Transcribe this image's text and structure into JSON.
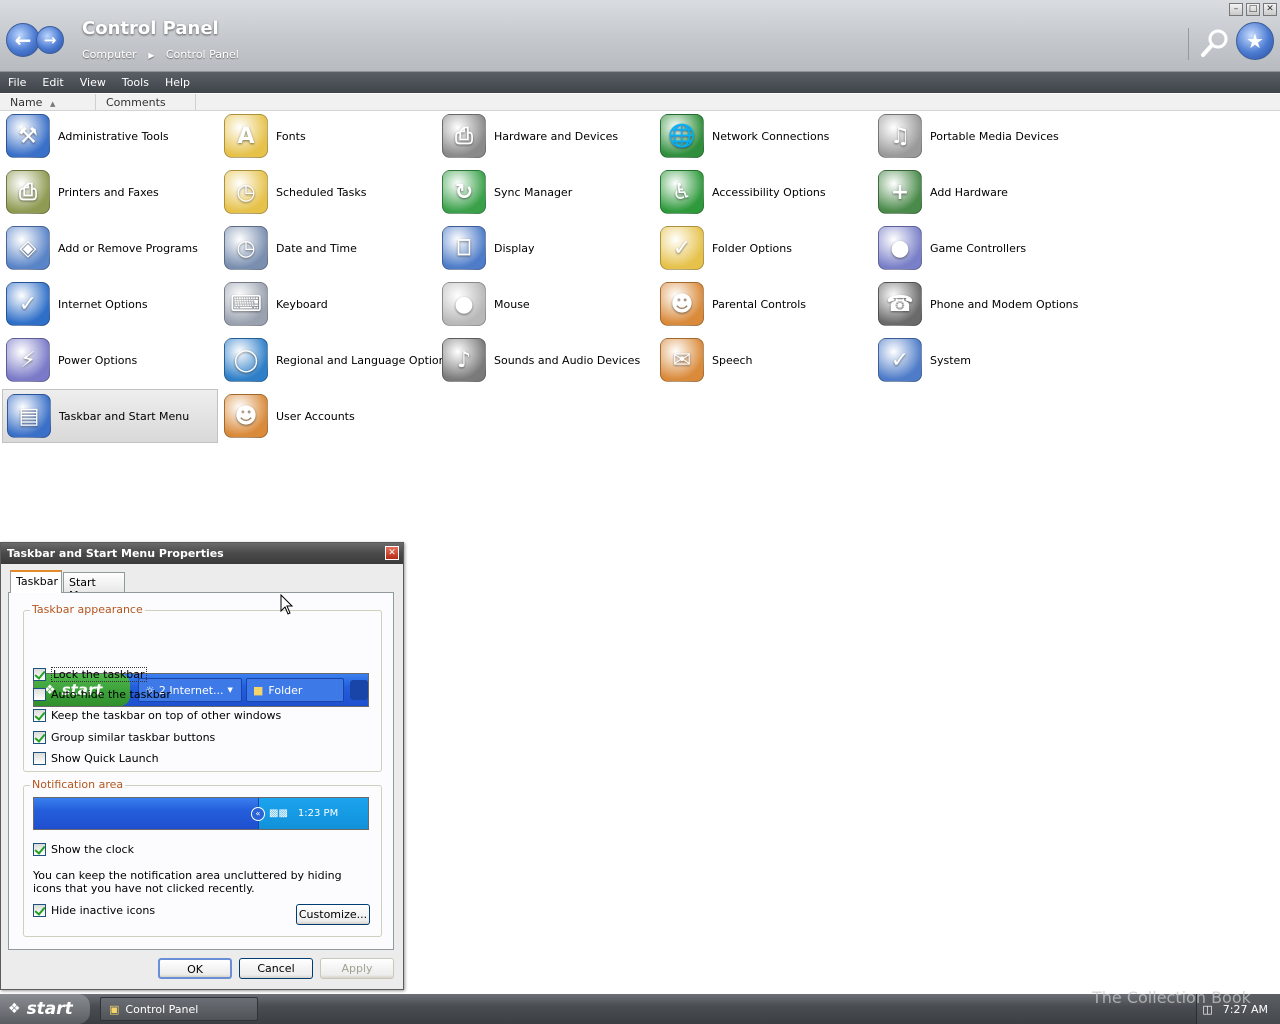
{
  "window": {
    "title": "Control Panel",
    "breadcrumb": [
      "Computer",
      "Control Panel"
    ]
  },
  "menu": [
    "File",
    "Edit",
    "View",
    "Tools",
    "Help"
  ],
  "columns": {
    "name": "Name",
    "comments": "Comments"
  },
  "items": [
    {
      "label": "Administrative Tools",
      "icon": "administrative-tools-icon"
    },
    {
      "label": "Fonts",
      "icon": "fonts-folder-icon"
    },
    {
      "label": "Hardware and Devices",
      "icon": "hardware-devices-icon"
    },
    {
      "label": "Network Connections",
      "icon": "network-connections-icon"
    },
    {
      "label": "Portable Media Devices",
      "icon": "portable-media-icon"
    },
    {
      "label": "Printers and Faxes",
      "icon": "printer-icon"
    },
    {
      "label": "Scheduled Tasks",
      "icon": "scheduled-tasks-icon"
    },
    {
      "label": "Sync Manager",
      "icon": "sync-icon"
    },
    {
      "label": "Accessibility Options",
      "icon": "accessibility-icon"
    },
    {
      "label": "Add Hardware",
      "icon": "add-hardware-icon"
    },
    {
      "label": "Add or Remove Programs",
      "icon": "add-remove-programs-icon"
    },
    {
      "label": "Date and Time",
      "icon": "clock-calendar-icon"
    },
    {
      "label": "Display",
      "icon": "display-icon"
    },
    {
      "label": "Folder Options",
      "icon": "folder-options-icon"
    },
    {
      "label": "Game Controllers",
      "icon": "gamepad-icon"
    },
    {
      "label": "Internet Options",
      "icon": "internet-globe-icon"
    },
    {
      "label": "Keyboard",
      "icon": "keyboard-icon"
    },
    {
      "label": "Mouse",
      "icon": "mouse-icon"
    },
    {
      "label": "Parental Controls",
      "icon": "parental-controls-icon"
    },
    {
      "label": "Phone and Modem Options",
      "icon": "phone-modem-icon"
    },
    {
      "label": "Power Options",
      "icon": "power-plug-icon"
    },
    {
      "label": "Regional and Language Options",
      "icon": "globe-icon"
    },
    {
      "label": "Sounds and Audio Devices",
      "icon": "speaker-icon"
    },
    {
      "label": "Speech",
      "icon": "speech-icon"
    },
    {
      "label": "System",
      "icon": "system-computer-icon"
    },
    {
      "label": "Taskbar and Start Menu",
      "icon": "taskbar-icon",
      "selected": true
    },
    {
      "label": "User Accounts",
      "icon": "user-accounts-icon"
    }
  ],
  "dialog": {
    "title": "Taskbar and Start Menu Properties",
    "tabs": [
      "Taskbar",
      "Start Menu"
    ],
    "active_tab": "Taskbar",
    "appearance_group": "Taskbar appearance",
    "preview": {
      "start": "start",
      "btn1": "2 Internet...",
      "btn2": "Folder"
    },
    "appearance_options": [
      {
        "label": "Lock the taskbar",
        "checked": true
      },
      {
        "label": "Auto-hide the taskbar",
        "checked": false
      },
      {
        "label": "Keep the taskbar on top of other windows",
        "checked": true
      },
      {
        "label": "Group similar taskbar buttons",
        "checked": true
      },
      {
        "label": "Show Quick Launch",
        "checked": false
      }
    ],
    "notification_group": "Notification area",
    "notify_preview_time": "1:23 PM",
    "show_clock": {
      "label": "Show the clock",
      "checked": true
    },
    "description": "You can keep the notification area uncluttered by hiding icons that you have not clicked recently.",
    "hide_inactive": {
      "label": "Hide inactive icons",
      "checked": true
    },
    "customize": "Customize...",
    "ok": "OK",
    "cancel": "Cancel",
    "apply": "Apply"
  },
  "taskbar": {
    "start": "start",
    "task": "Control Panel",
    "clock": "7:27 AM"
  },
  "watermark": "The Collection Book"
}
